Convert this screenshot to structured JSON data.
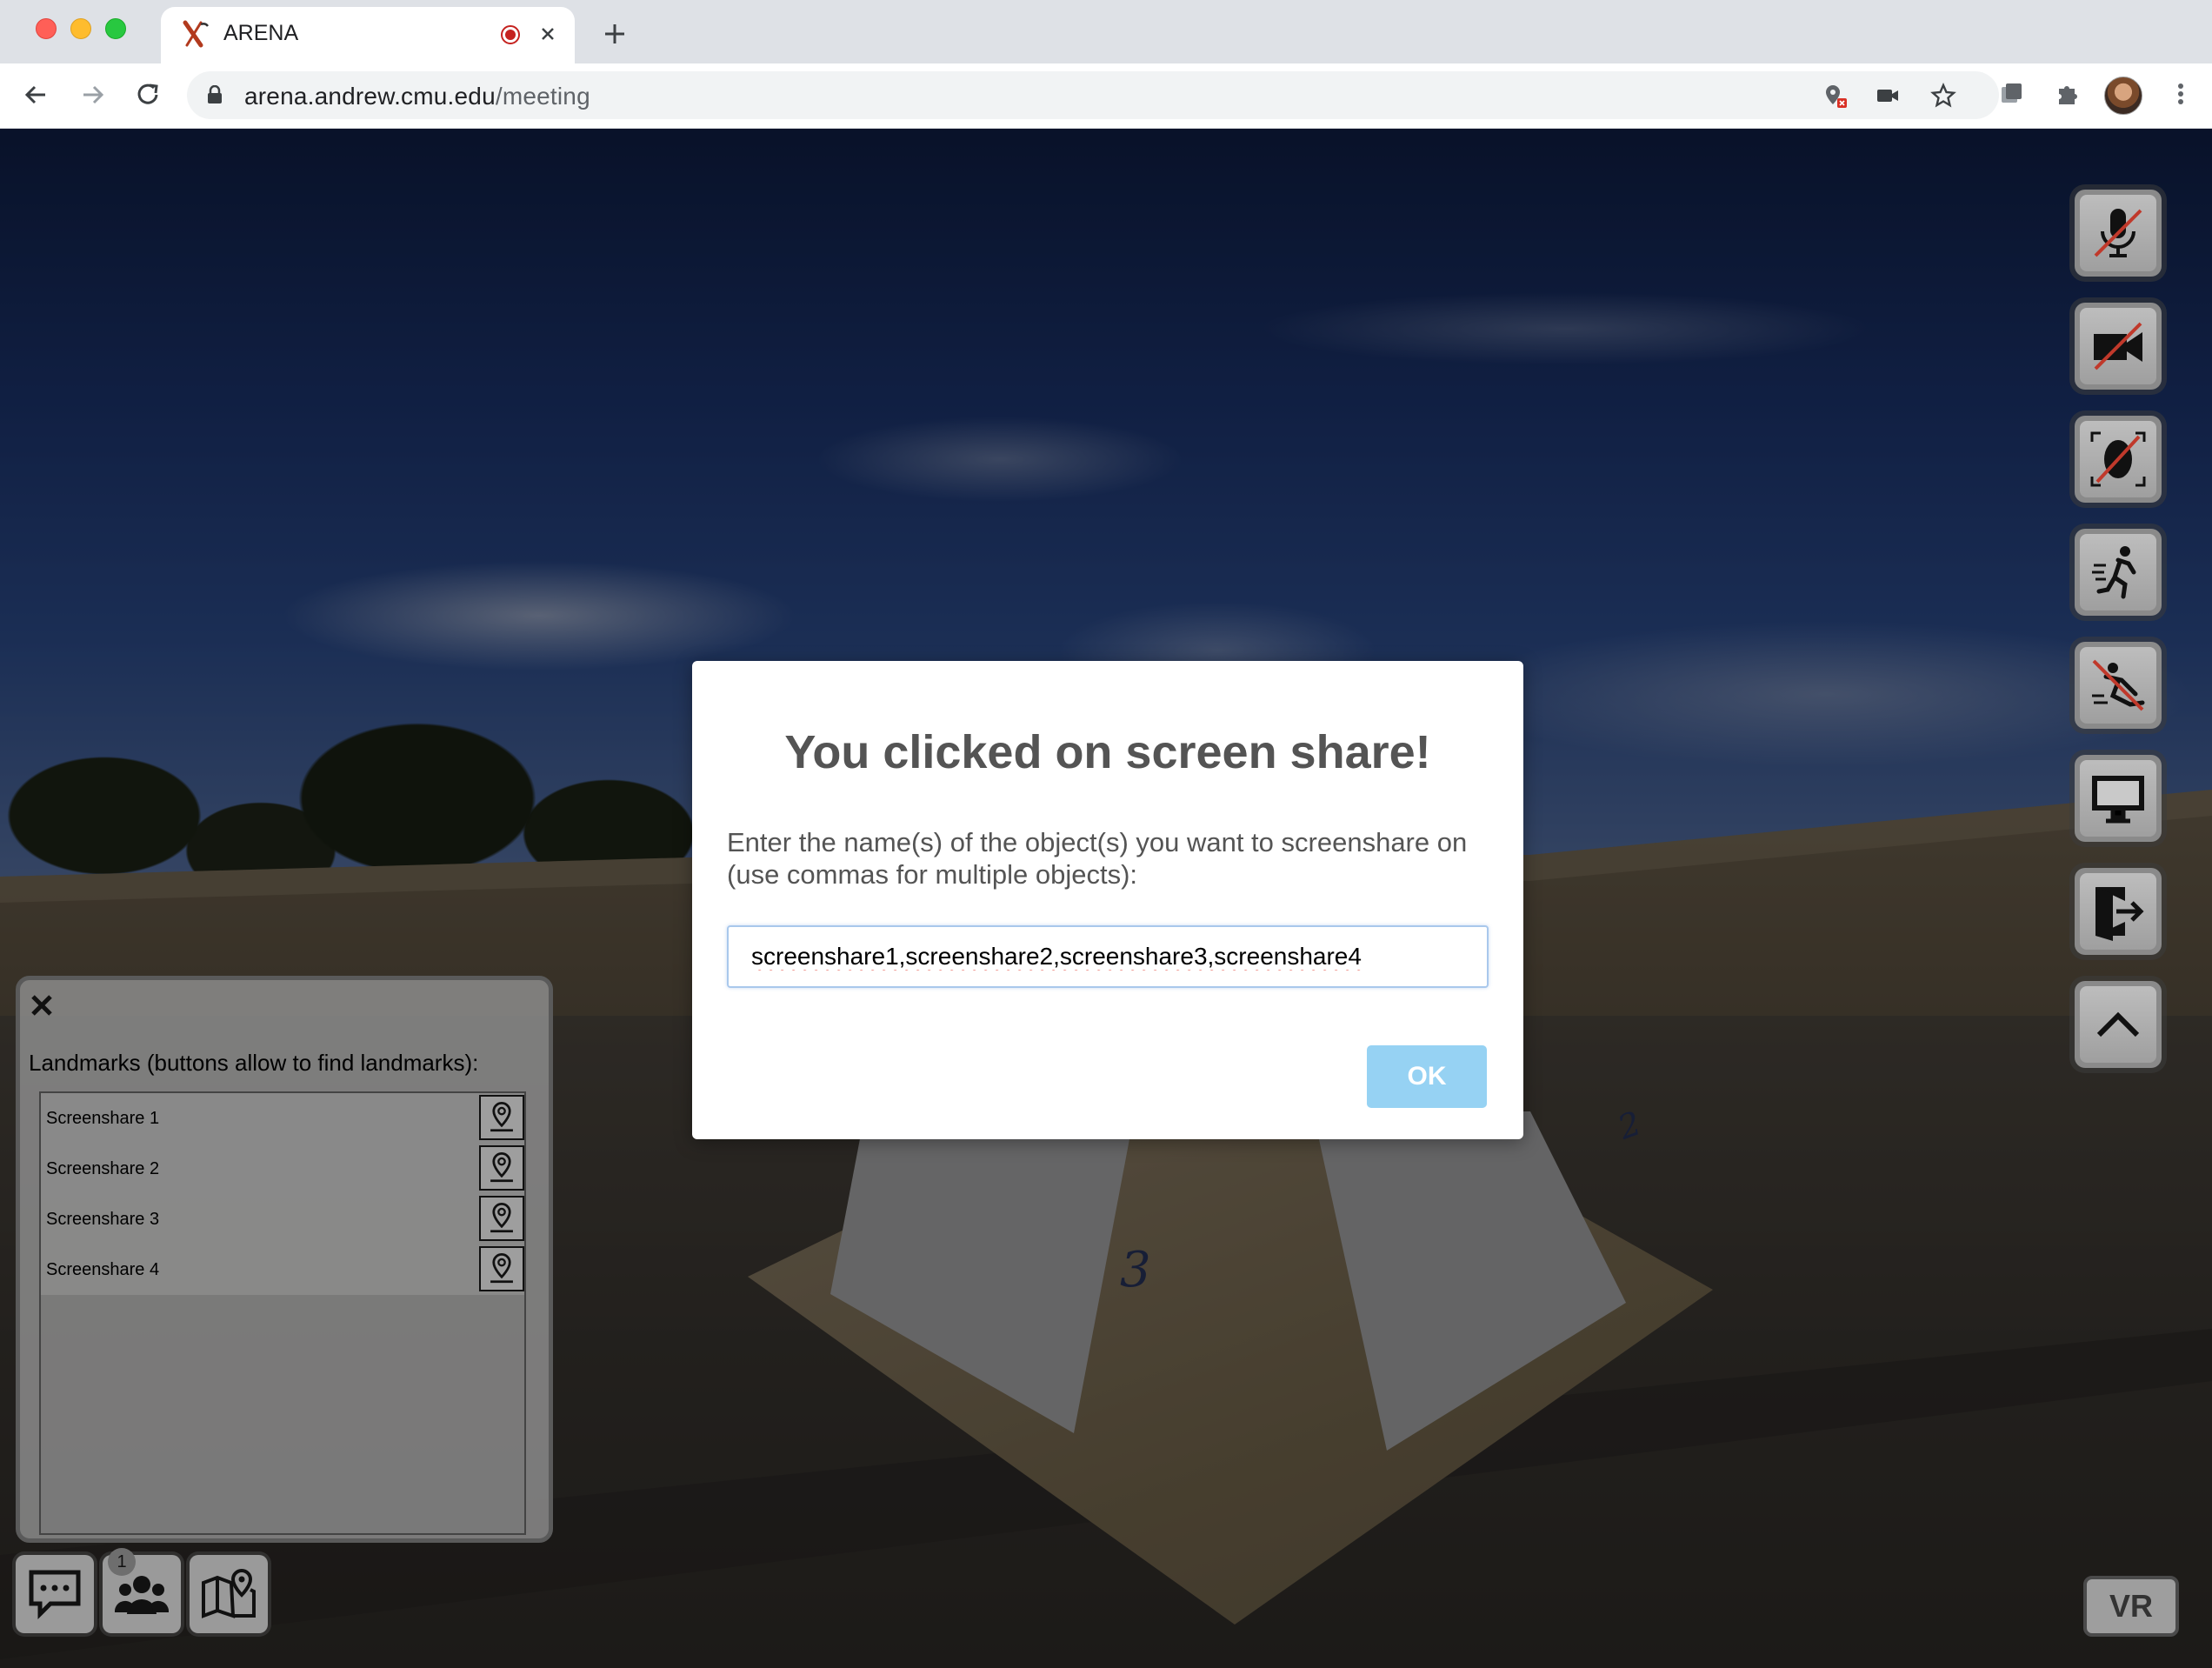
{
  "browser": {
    "tab_title": "ARENA",
    "url_host": "arena.andrew.cmu.edu",
    "url_path": "/meeting"
  },
  "scene": {
    "label_panel_3": "3",
    "label_panel_2": "2"
  },
  "dialog": {
    "title": "You clicked on screen share!",
    "message": "Enter the name(s) of the object(s) you want to screenshare on (use commas for multiple objects):",
    "input_value": "screenshare1,screenshare2,screenshare3,screenshare4",
    "ok_label": "OK"
  },
  "side_controls": [
    {
      "icon": "microphone-muted-icon"
    },
    {
      "icon": "camera-off-icon"
    },
    {
      "icon": "face-tracking-off-icon"
    },
    {
      "icon": "fly-mode-icon"
    },
    {
      "icon": "flying-off-icon"
    },
    {
      "icon": "screen-share-icon"
    },
    {
      "icon": "logout-icon"
    },
    {
      "icon": "chevron-up-icon"
    }
  ],
  "landmarks": {
    "heading": "Landmarks (buttons allow to find landmarks):",
    "items": [
      {
        "label": "Screenshare 1"
      },
      {
        "label": "Screenshare 2"
      },
      {
        "label": "Screenshare 3"
      },
      {
        "label": "Screenshare 4"
      }
    ]
  },
  "bottom_bar": {
    "users_badge": "1",
    "vr_label": "VR"
  },
  "colors": {
    "ok_button": "#96d2f3",
    "dialog_text": "#545454",
    "mute_slash": "#c0392b"
  }
}
